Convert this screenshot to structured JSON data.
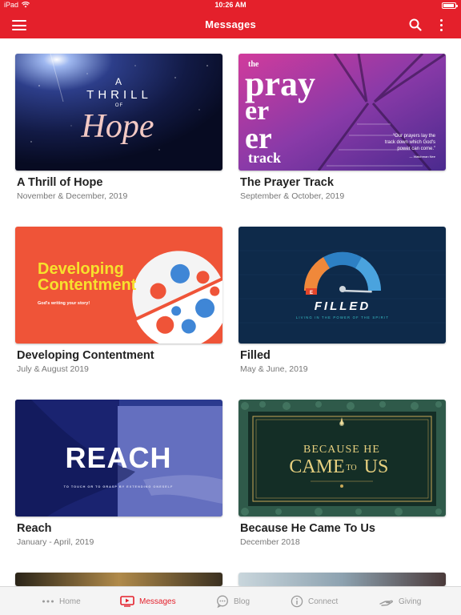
{
  "status": {
    "device": "iPad",
    "time": "10:26 AM"
  },
  "nav": {
    "title": "Messages"
  },
  "cards": [
    {
      "title": "A Thrill of Hope",
      "date": "November & December, 2019",
      "art": {
        "line1": "A",
        "line2": "THRILL",
        "line3": "OF",
        "line4": "Hope"
      }
    },
    {
      "title": "The Prayer Track",
      "date": "September & October, 2019",
      "art": {
        "the": "the",
        "w1": "pray",
        "w2": "er",
        "w3": "track",
        "quote1": "“Our prayers lay the",
        "quote2": "track down which God's",
        "quote3": "power can come.”",
        "author": "— Watchman Nee"
      }
    },
    {
      "title": "Developing Contentment",
      "date": "July & August 2019",
      "art": {
        "line1": "Developing",
        "line2": "Contentment",
        "sub": "God's writing your story!"
      }
    },
    {
      "title": "Filled",
      "date": "May & June, 2019",
      "art": {
        "word": "FILLED",
        "sub": "LIVING IN THE POWER OF THE SPIRIT",
        "gauge_min": "E",
        "gauge_fill": 0.85
      }
    },
    {
      "title": "Reach",
      "date": "January - April, 2019",
      "art": {
        "word": "REACH",
        "sub": "TO TOUCH OR TO GRASP BY EXTENDING ONESELF"
      }
    },
    {
      "title": "Because He Came To Us",
      "date": "December 2018",
      "art": {
        "line1": "BECAUSE HE",
        "came": "CAME",
        "to": "TO",
        "us": "US"
      }
    }
  ],
  "tabs": [
    {
      "label": "Home",
      "icon": "ellipsis-icon"
    },
    {
      "label": "Messages",
      "icon": "video-icon"
    },
    {
      "label": "Blog",
      "icon": "chat-bubble-icon"
    },
    {
      "label": "Connect",
      "icon": "info-icon"
    },
    {
      "label": "Giving",
      "icon": "giving-hands-icon"
    }
  ],
  "colors": {
    "brand": "#e4202b",
    "inactive": "#9a9a9a"
  }
}
